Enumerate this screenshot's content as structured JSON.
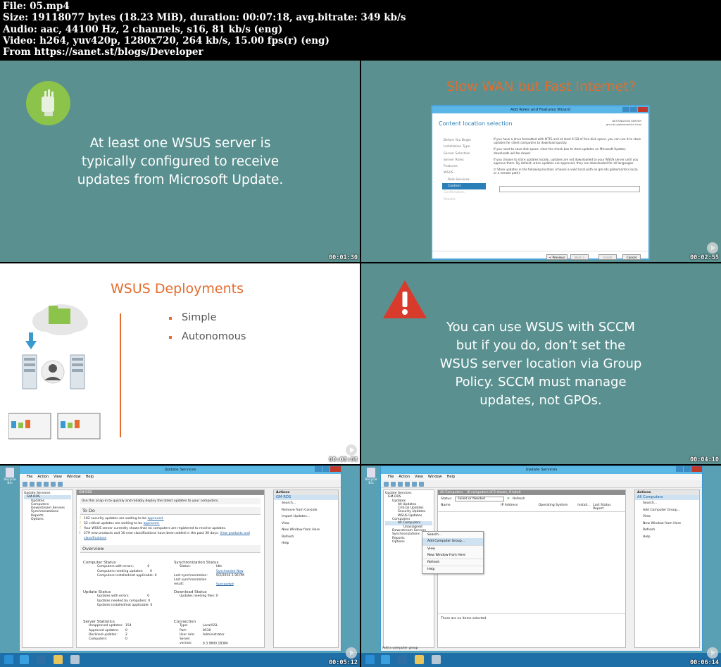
{
  "header": {
    "line1": "File: 05.mp4",
    "line2": "Size: 19118077 bytes (18.23 MiB), duration: 00:07:18, avg.bitrate: 349 kb/s",
    "line3": "Audio: aac, 44100 Hz, 2 channels, s16, 81 kb/s (eng)",
    "line4": "Video: h264, yuv420p, 1280x720, 264 kb/s, 15.00 fps(r) (eng)",
    "line5": "From https://sanet.st/blogs/Developer"
  },
  "frames": [
    {
      "timestamp": "00:01:30",
      "text_line1": "At least one WSUS server is",
      "text_line2": "typically configured to receive",
      "text_line3": "updates from Microsoft Update."
    },
    {
      "timestamp": "00:02:55",
      "title": "Slow WAN but Fast Internet?",
      "wizard": {
        "window_title": "Add Roles and Features Wizard",
        "heading": "Content location selection",
        "destination_label": "DESTINATION SERVER",
        "destination_value": "gm-rds.globomantics.local",
        "nav": [
          "Before You Begin",
          "Installation Type",
          "Server Selection",
          "Server Roles",
          "Features",
          "WSUS",
          "Role Services",
          "Content",
          "Confirmation",
          "Results"
        ],
        "para1": "If you have a drive formatted with NTFS and at least 6 GB of free disk space, you can use it to store updates for client computers to download quickly.",
        "para2": "If you need to save disk space, clear the check box to store updates on Microsoft Update; downloads will be slower.",
        "para3": "If you choose to store updates locally, updates are not downloaded to your WSUS server until you approve them. By default, when updates are approved, they are downloaded for all languages.",
        "checkbox_label": "Store updates in the following location (choose a valid local path on gm-rds.globomantics.local, or a remote path):",
        "btn_prev": "< Previous",
        "btn_next": "Next >",
        "btn_install": "Install",
        "btn_cancel": "Cancel"
      }
    },
    {
      "timestamp": "00:03:08",
      "title": "WSUS Deployments",
      "bullet1": "Simple",
      "bullet2": "Autonomous"
    },
    {
      "timestamp": "00:04:10",
      "text_line1": "You can use WSUS with SCCM",
      "text_line2": "but if you do, don’t set the",
      "text_line3": "WSUS server location via Group",
      "text_line4": "Policy. SCCM must manage",
      "text_line5": "updates, not GPOs."
    },
    {
      "timestamp": "00:05:12",
      "window_title": "Update Services",
      "recycle_label": "Recycle Bin",
      "menu": [
        "File",
        "Action",
        "View",
        "Window",
        "Help"
      ],
      "tree": [
        "Update Services",
        "GM-RDS",
        "Updates",
        "Computers",
        "Downstream Servers",
        "Synchronizations",
        "Reports",
        "Options"
      ],
      "center_header": "GM-RDS",
      "snapin_text": "Use this snap-in to quickly and reliably deploy the latest updates to your computers.",
      "todo_title": "To Do",
      "todo1_pre": "102 security updates are waiting to be ",
      "todo_link": "approved.",
      "todo2_pre": "52 critical updates are waiting to be ",
      "todo3": "Your WSUS server currently shows that no computers are registered to receive updates.",
      "todo4_pre": "279 new products and 10 new classifications have been added in the past 30 days. ",
      "todo4_link": "View products and classifications",
      "overview_title": "Overview",
      "computer_status": "Computer Status",
      "cs1": "Computers with errors:",
      "cs2": "Computers needing updates:",
      "cs3": "Computers installed/not applicable:",
      "cs_val": "0",
      "sync_status": "Synchronization Status",
      "sync_status_label": "Status:",
      "sync_status_val": "Idle",
      "sync_now": "Synchronize Now",
      "last_sync_label": "Last synchronization:",
      "last_sync_val": "9/2/2016 3:36 PM",
      "last_result_label": "Last synchronization result:",
      "last_result_val": "Succeeded",
      "update_status": "Update Status",
      "us1": "Updates with errors:",
      "us2": "Updates needed by computers:",
      "us3": "Updates installed/not applicable:",
      "download_status": "Download Status",
      "dl_label": "Updates needing files:",
      "dl_val": "0",
      "server_stats": "Server Statistics",
      "ss1": "Unapproved updates:",
      "ss1v": "154",
      "ss2": "Approved updates:",
      "ss2v": "0",
      "ss3": "Declined updates:",
      "ss3v": "2",
      "ss4": "Computers:",
      "ss4v": "0",
      "connection": "Connection",
      "cn1": "Type:",
      "cn1v": "Local/SSL",
      "cn2": "Port:",
      "cn2v": "8530",
      "cn3": "User role:",
      "cn3v": "Administrator",
      "cn4": "Server version:",
      "cn4v": "6.3.9600.18384",
      "actions_title": "Actions",
      "actions_sel": "GM-RDS",
      "actions": [
        "Search...",
        "Remove from Console",
        "Import Updates...",
        "View",
        "New Window from Here",
        "Refresh",
        "Help"
      ]
    },
    {
      "timestamp": "00:06:14",
      "window_title": "Update Services",
      "recycle_label": "Recycle Bin",
      "menu": [
        "File",
        "Action",
        "View",
        "Window",
        "Help"
      ],
      "tree": [
        "Update Services",
        "GM-RDS",
        "Updates",
        "All Updates",
        "Critical Updates",
        "Security Updates",
        "WSUS Updates",
        "Computers",
        "All Computers",
        "Unassigned",
        "Downstream Servers",
        "Synchronizations",
        "Reports",
        "Options"
      ],
      "center_header": "All Computers",
      "center_sub": "(0 computers of 0 shown, 0 total)",
      "status_label": "Status:",
      "status_val": "Failed or Needed",
      "refresh": "Refresh",
      "cols": [
        "Name",
        "IP Address",
        "Operating System",
        "Install...",
        "Last Status Report"
      ],
      "no_items": "There are no items selected",
      "ctx": [
        "Search...",
        "Add Computer Group...",
        "View",
        "New Window from Here",
        "Refresh",
        "Help"
      ],
      "actions_title": "Actions",
      "actions_sel": "All Computers",
      "actions": [
        "Search...",
        "Add Computer Group...",
        "View",
        "New Window from Here",
        "Refresh",
        "Help"
      ],
      "statusbar": "Add a computer group"
    }
  ],
  "colors": {
    "teal": "#5a9190",
    "orange": "#e46c2e",
    "green": "#8cc34a",
    "red": "#d83b2b"
  }
}
